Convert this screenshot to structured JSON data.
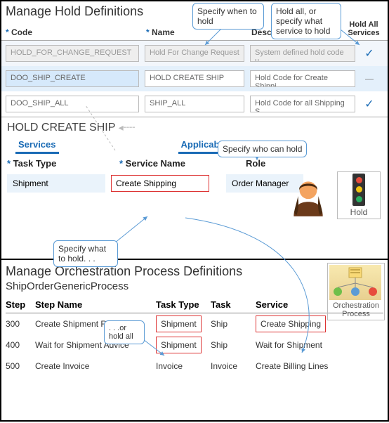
{
  "holdDef": {
    "title": "Manage Hold Definitions",
    "columns": {
      "code": "Code",
      "name": "Name",
      "desc": "Desc",
      "holdAll": "Hold All Services"
    },
    "rows": [
      {
        "code": "HOLD_FOR_CHANGE_REQUEST",
        "name": "Hold For Change Request",
        "desc": "System defined hold code u...",
        "holdAll": "✓",
        "disabled": true
      },
      {
        "code": "DOO_SHIP_CREATE",
        "name": "HOLD CREATE SHIP",
        "desc": "Hold Code for Create Shippi",
        "holdAll": "—",
        "selected": true
      },
      {
        "code": "DOO_SHIP_ALL",
        "name": "SHIP_ALL",
        "desc": "Hold Code for all Shipping S",
        "holdAll": "✓"
      }
    ],
    "detailTitle": "HOLD CREATE SHIP",
    "tabs": [
      "Services",
      "Applicable Roles"
    ],
    "subHeaders": {
      "taskType": "Task Type",
      "serviceName": "Service Name",
      "role": "Role"
    },
    "detailRow": {
      "taskType": "Shipment",
      "serviceName": "Create Shipping",
      "role": "Order Manager"
    },
    "holdIconLabel": "Hold"
  },
  "callouts": {
    "whenToHold": "Specify when to hold",
    "whatService": "Hold all, or specify what service to hold",
    "whoCanHold": "Specify who can hold",
    "whatToHold": "Specify what to hold. . .",
    "orHoldAll": ". . .or hold all"
  },
  "orch": {
    "title": "Manage Orchestration Process Definitions",
    "subtitle": "ShipOrderGenericProcess",
    "iconLabel": "Orchestration Process",
    "columns": {
      "step": "Step",
      "stepName": "Step Name",
      "taskType": "Task Type",
      "task": "Task",
      "service": "Service"
    },
    "rows": [
      {
        "step": "300",
        "stepName": "Create Shipment Request",
        "taskType": "Shipment",
        "task": "Ship",
        "service": "Create Shipping",
        "redTT": true,
        "redSvc": true
      },
      {
        "step": "400",
        "stepName": "Wait for Shipment Advice",
        "taskType": "Shipment",
        "task": "Ship",
        "service": "Wait for Shipment",
        "redTT": true
      },
      {
        "step": "500",
        "stepName": "Create Invoice",
        "taskType": "Invoice",
        "task": "Invoice",
        "service": "Create Billing Lines"
      }
    ]
  }
}
